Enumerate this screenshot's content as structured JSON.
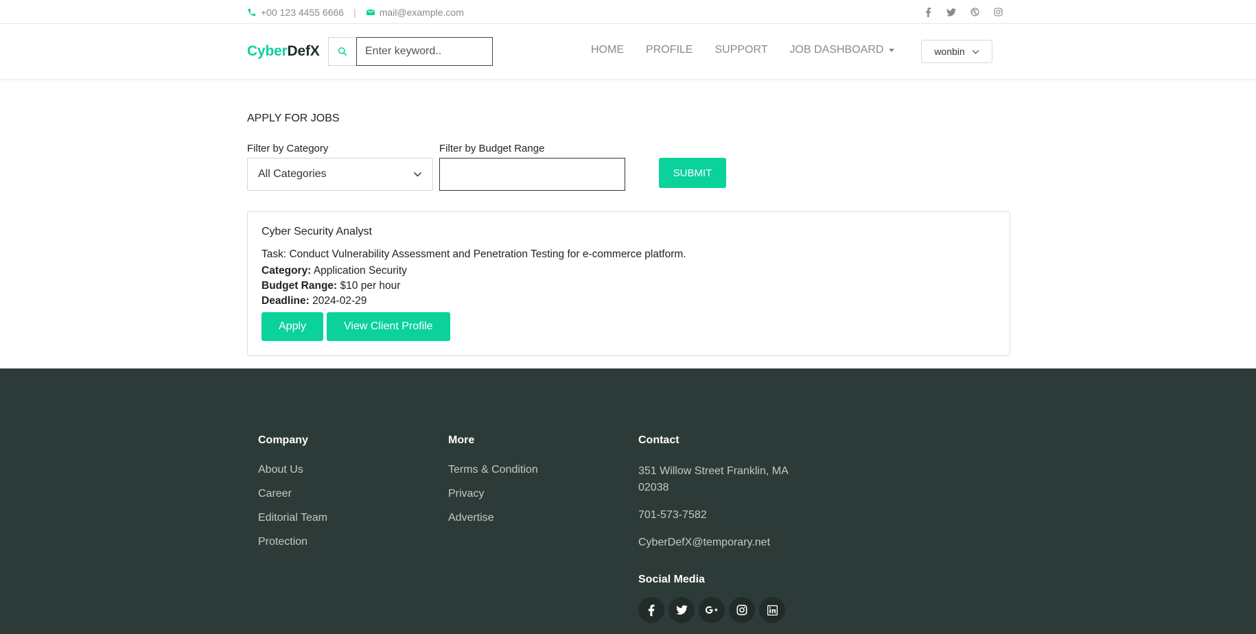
{
  "topbar": {
    "phone": "+00 123 4455 6666",
    "separator": "|",
    "email": "mail@example.com",
    "social_icons": [
      "facebook-icon",
      "twitter-icon",
      "dribbble-icon",
      "instagram-icon"
    ]
  },
  "header": {
    "logo_part1": "Cyber",
    "logo_part2": "DefX",
    "search_placeholder": "Enter keyword..",
    "nav": [
      "HOME",
      "PROFILE",
      "SUPPORT",
      "JOB DASHBOARD"
    ],
    "user": "wonbin"
  },
  "main": {
    "title": "APPLY FOR JOBS",
    "filter_category_label": "Filter by Category",
    "filter_category_value": "All Categories",
    "filter_budget_label": "Filter by Budget Range",
    "filter_budget_value": "",
    "submit_label": "SUBMIT",
    "job": {
      "title": "Cyber Security Analyst",
      "task": "Task: Conduct Vulnerability Assessment and Penetration Testing for e-commerce platform.",
      "category_label": "Category:",
      "category": "Application Security",
      "budget_label": "Budget Range:",
      "budget": "$10 per hour",
      "deadline_label": "Deadline:",
      "deadline": "2024-02-29",
      "apply_label": "Apply",
      "view_client_label": "View Client Profile"
    }
  },
  "footer": {
    "company": {
      "heading": "Company",
      "links": [
        "About Us",
        "Career",
        "Editorial Team",
        "Protection"
      ]
    },
    "more": {
      "heading": "More",
      "links": [
        "Terms & Condition",
        "Privacy",
        "Advertise"
      ]
    },
    "contact": {
      "heading": "Contact",
      "address_line1": "351 Willow Street Franklin, MA",
      "address_line2": "02038",
      "phone": "701-573-7582",
      "email": "CyberDefX@temporary.net"
    },
    "social": {
      "heading": "Social Media",
      "icons": [
        "facebook-icon",
        "twitter-icon",
        "google-plus-icon",
        "instagram-icon",
        "linkedin-icon"
      ]
    }
  },
  "colors": {
    "accent": "#0bd19b",
    "footer_bg": "#2d3b38"
  }
}
